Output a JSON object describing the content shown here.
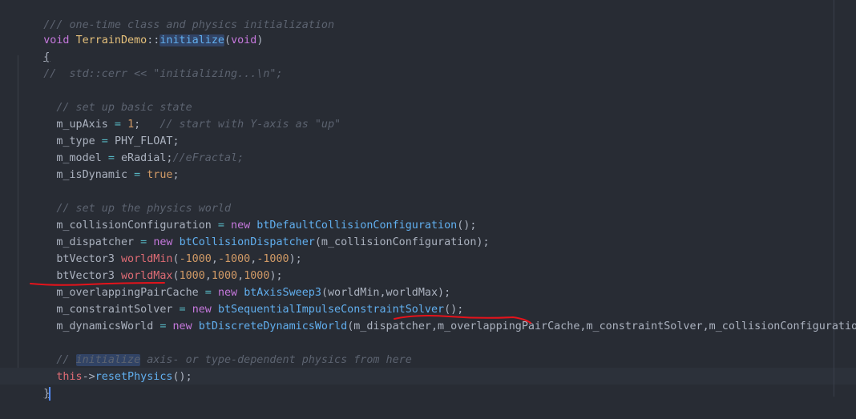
{
  "code": {
    "l01_comment": "/// one-time class and physics initialization",
    "l02_void": "void",
    "l02_class": "TerrainDemo",
    "l02_scope": "::",
    "l02_func": "initialize",
    "l02_paren_open": "(",
    "l02_param": "void",
    "l02_paren_close": ")",
    "l03_brace": "{",
    "l04_comment": "//  std::cerr << \"initializing...\\n\";",
    "l06_comment": "// set up basic state",
    "l07_var": "m_upAxis",
    "l07_eq": " = ",
    "l07_num": "1",
    "l07_semi": ";   ",
    "l07_comment": "// start with Y-axis as \"up\"",
    "l08_var": "m_type",
    "l08_eq": " = ",
    "l08_val": "PHY_FLOAT;",
    "l09_var": "m_model",
    "l09_eq": " = ",
    "l09_val": "eRadial;",
    "l09_comment": "//eFractal;",
    "l10_var": "m_isDynamic",
    "l10_eq": " = ",
    "l10_val": "true",
    "l10_semi": ";",
    "l12_comment": "// set up the physics world",
    "l13_var": "m_collisionConfiguration",
    "l13_eq": " = ",
    "l13_new": "new",
    "l13_call": "btDefaultCollisionConfiguration",
    "l13_rest": "();",
    "l14_var": "m_dispatcher",
    "l14_eq": " = ",
    "l14_new": "new",
    "l14_call": "btCollisionDispatcher",
    "l14_rest": "(m_collisionConfiguration);",
    "l15_type": "btVector3 ",
    "l15_name": "worldMin",
    "l15_open": "(",
    "l15_n1": "-1000",
    "l15_c1": ",",
    "l15_n2": "-1000",
    "l15_c2": ",",
    "l15_n3": "-1000",
    "l15_close": ");",
    "l16_type": "btVector3 ",
    "l16_name": "worldMax",
    "l16_open": "(",
    "l16_n1": "1000",
    "l16_c1": ",",
    "l16_n2": "1000",
    "l16_c2": ",",
    "l16_n3": "1000",
    "l16_close": ");",
    "l17_var": "m_overlappingPairCache",
    "l17_eq": " = ",
    "l17_new": "new",
    "l17_call": "btAxisSweep3",
    "l17_rest": "(worldMin,worldMax);",
    "l18_var": "m_constraintSolver",
    "l18_eq": " = ",
    "l18_new": "new",
    "l18_call": "btSequentialImpulseConstraintSolver",
    "l18_rest": "();",
    "l19_var": "m_dynamicsWorld",
    "l19_eq": " = ",
    "l19_new": "new",
    "l19_call": "btDiscreteDynamicsWorld",
    "l19_rest": "(m_dispatcher,m_overlappingPairCache,m_constraintSolver,m_collisionConfiguration);",
    "l21_comment_a": "// ",
    "l21_comment_hl": "initialize",
    "l21_comment_b": " axis- or type-dependent physics from here",
    "l22_this": "this",
    "l22_arrow": "->",
    "l22_call": "resetPhysics",
    "l22_rest": "();",
    "l23_brace": "}"
  },
  "colors": {
    "background": "#282c34",
    "annotation_underline": "#e5131b",
    "selection_highlight": "#314365"
  }
}
